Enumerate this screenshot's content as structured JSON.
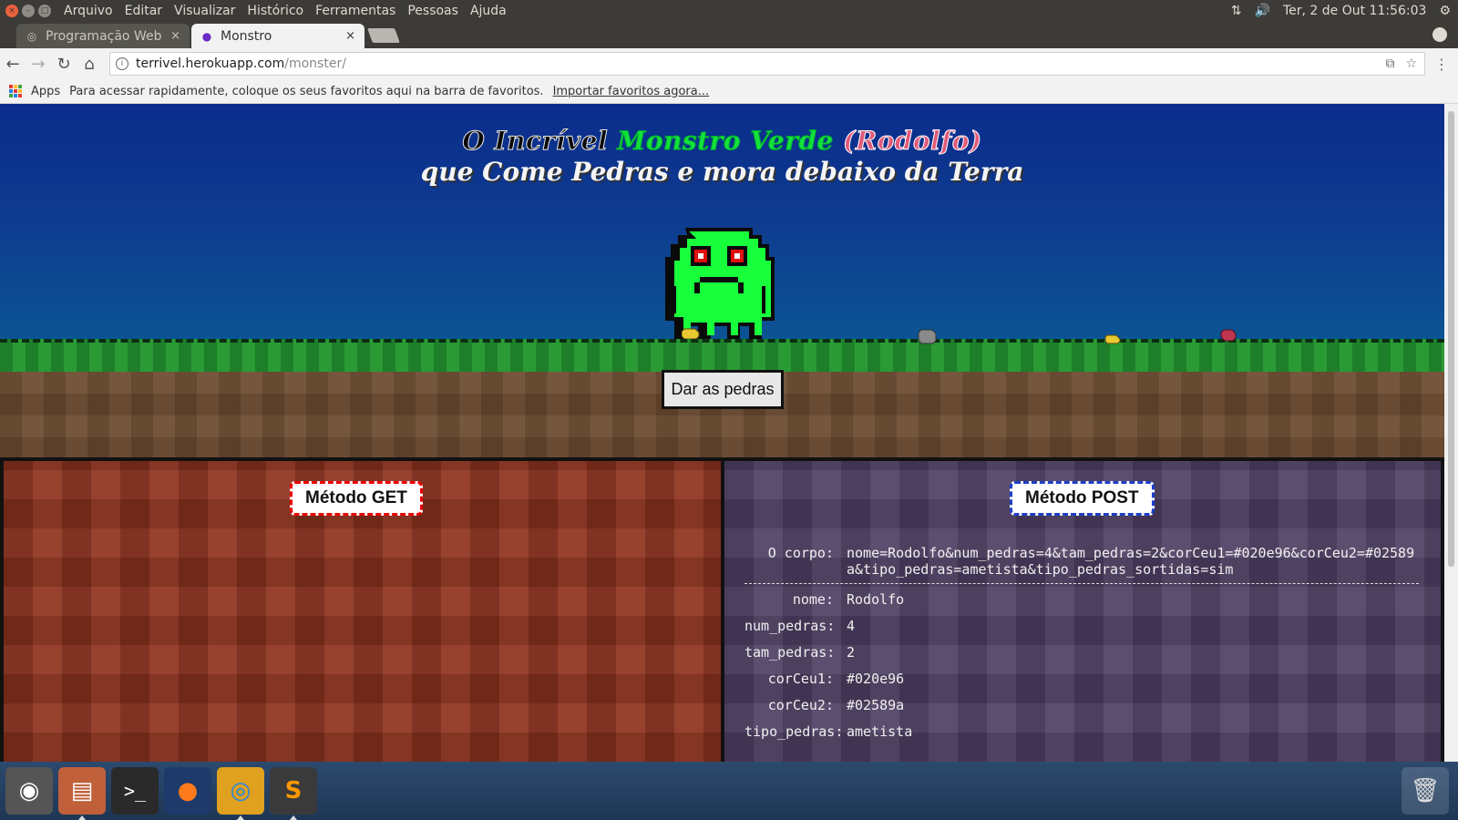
{
  "topbar": {
    "menu": [
      "Arquivo",
      "Editar",
      "Visualizar",
      "Histórico",
      "Ferramentas",
      "Pessoas",
      "Ajuda"
    ],
    "datetime": "Ter, 2 de Out 11:56:03"
  },
  "tabs": [
    {
      "label": "Programação Web",
      "active": false
    },
    {
      "label": "Monstro",
      "active": true
    }
  ],
  "omnibox": {
    "host": "terrivel.herokuapp.com",
    "path": "/monster/"
  },
  "bookmarks": {
    "apps_label": "Apps",
    "prompt": "Para acessar rapidamente, coloque os seus favoritos aqui na barra de favoritos.",
    "import_link": "Importar favoritos agora..."
  },
  "page": {
    "title_part1": "O Incrível",
    "title_part2": "Monstro Verde",
    "title_part3": "(Rodolfo)",
    "title_line2": "que Come Pedras e mora debaixo da Terra",
    "give_button": "Dar as pedras",
    "get_badge": "Método GET",
    "post_badge": "Método POST",
    "post_body_label": "O corpo:",
    "post_body_value": "nome=Rodolfo&num_pedras=4&tam_pedras=2&corCeu1=#020e96&corCeu2=#02589a&tipo_pedras=ametista&tipo_pedras_sortidas=sim",
    "fields": [
      {
        "key": "nome:",
        "value": "Rodolfo"
      },
      {
        "key": "num_pedras:",
        "value": "4"
      },
      {
        "key": "tam_pedras:",
        "value": "2"
      },
      {
        "key": "corCeu1:",
        "value": "#020e96"
      },
      {
        "key": "corCeu2:",
        "value": "#02589a"
      },
      {
        "key": "tipo_pedras:",
        "value": "ametista"
      }
    ]
  },
  "colors": {
    "monster_green": "#18ff3c",
    "monster_eye": "#e01010",
    "sky_top": "#020e96",
    "sky_bottom": "#02589a"
  }
}
